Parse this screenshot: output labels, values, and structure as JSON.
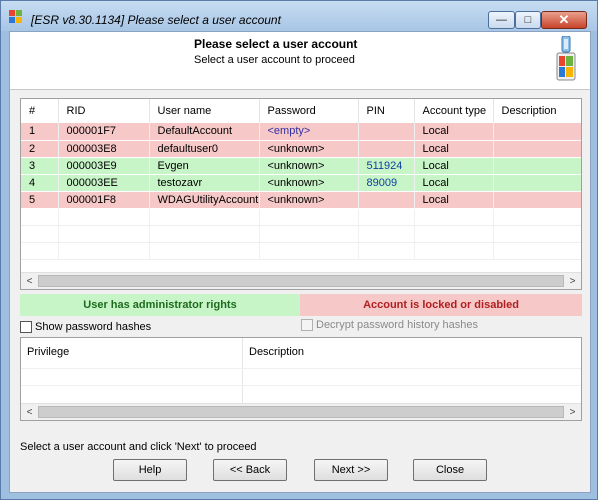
{
  "window": {
    "title": "[ESR v8.30.1134]  Please select a user account",
    "controls": {
      "minimize": "—",
      "maximize": "□",
      "close": "✕"
    }
  },
  "header": {
    "title": "Please select a user account",
    "subtitle": "Select a user account to proceed"
  },
  "accounts": {
    "columns": [
      "#",
      "RID",
      "User name",
      "Password",
      "PIN",
      "Account type",
      "Description"
    ],
    "rows": [
      {
        "num": "1",
        "rid": "000001F7",
        "user": "DefaultAccount",
        "password": "<empty>",
        "pin": "",
        "type": "Local",
        "desc": "",
        "status": "locked"
      },
      {
        "num": "2",
        "rid": "000003E8",
        "user": "defaultuser0",
        "password": "<unknown>",
        "pin": "",
        "type": "Local",
        "desc": "",
        "status": "locked"
      },
      {
        "num": "3",
        "rid": "000003E9",
        "user": "Evgen",
        "password": "<unknown>",
        "pin": "511924",
        "type": "Local",
        "desc": "",
        "status": "admin"
      },
      {
        "num": "4",
        "rid": "000003EE",
        "user": "testozavr",
        "password": "<unknown>",
        "pin": "89009",
        "type": "Local",
        "desc": "",
        "status": "admin"
      },
      {
        "num": "5",
        "rid": "000001F8",
        "user": "WDAGUtilityAccount",
        "password": "<unknown>",
        "pin": "",
        "type": "Local",
        "desc": "",
        "status": "locked"
      }
    ],
    "scroll_left": "<",
    "scroll_right": ">"
  },
  "legend": {
    "admin": "User has administrator rights",
    "locked": "Account is locked or disabled",
    "admin_color": "#c8f5c8",
    "locked_color": "#f7c8c8"
  },
  "options": {
    "show_hashes": "Show password hashes",
    "decrypt_history": "Decrypt password history hashes"
  },
  "privileges": {
    "col_privilege": "Privilege",
    "col_description": "Description"
  },
  "status": "Select a user account and click 'Next' to proceed",
  "buttons": {
    "help": "Help",
    "back": "<< Back",
    "next": "Next >>",
    "close": "Close"
  }
}
